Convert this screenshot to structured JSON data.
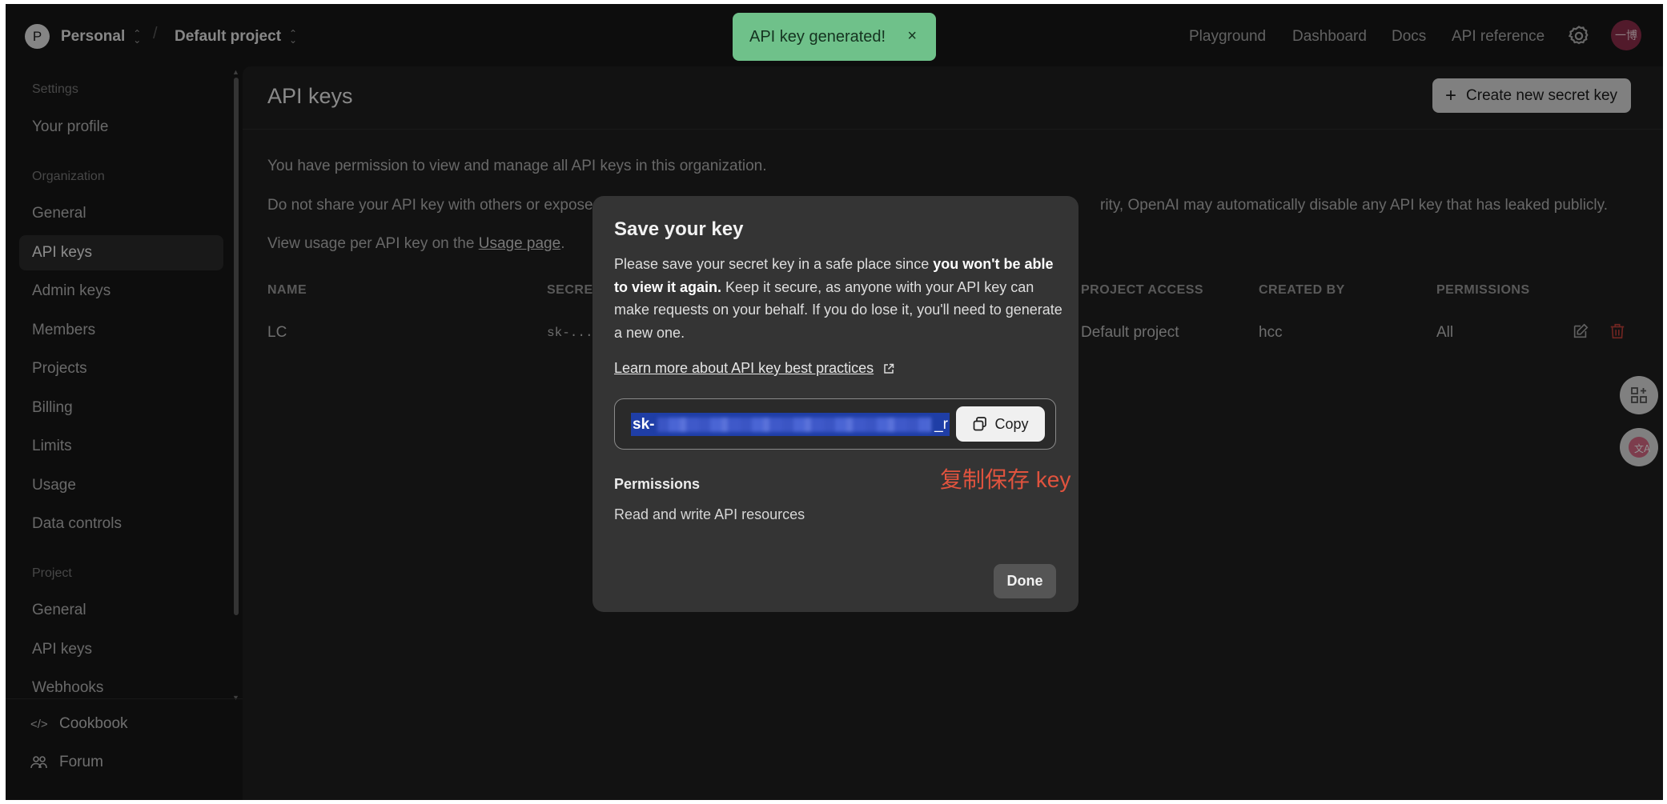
{
  "topbar": {
    "org_initial": "P",
    "org_name": "Personal",
    "project_name": "Default project",
    "separator": "/",
    "nav": [
      "Playground",
      "Dashboard",
      "Docs",
      "API reference"
    ],
    "user_avatar_text": "一博"
  },
  "toast": {
    "message": "API key generated!",
    "close": "×"
  },
  "sidebar": {
    "settings_heading": "Settings",
    "your_profile": "Your profile",
    "organization_heading": "Organization",
    "org_items": [
      "General",
      "API keys",
      "Admin keys",
      "Members",
      "Projects",
      "Billing",
      "Limits",
      "Usage",
      "Data controls"
    ],
    "project_heading": "Project",
    "project_items": [
      "General",
      "API keys",
      "Webhooks"
    ],
    "footer_items": [
      "Cookbook",
      "Forum"
    ]
  },
  "main": {
    "title": "API keys",
    "create_button": "Create new secret key",
    "para1": "You have permission to view and manage all API keys in this organization.",
    "para2_start": "Do not share your API key with others or expose it",
    "para2_end": "rity, OpenAI may automatically disable any API key that has leaked publicly.",
    "para3_prefix": "View usage per API key on the",
    "para3_link": "Usage page",
    "para3_suffix": ".",
    "table": {
      "headers": [
        "NAME",
        "SECRE",
        "PROJECT ACCESS",
        "CREATED BY",
        "PERMISSIONS"
      ],
      "rows": [
        {
          "name": "LC",
          "secret": "sk-...",
          "project": "Default project",
          "created_by": "hcc",
          "permissions": "All"
        }
      ]
    }
  },
  "modal": {
    "title": "Save your key",
    "body_start": "Please save your secret key in a safe place since ",
    "body_bold": "you won't be able to view it again.",
    "body_end": " Keep it secure, as anyone with your API key can make requests on your behalf. If you do lose it, you'll need to generate a new one.",
    "learn_more": "Learn more about API key best practices",
    "key_prefix": "sk-",
    "key_suffix": "_r",
    "copy_label": "Copy",
    "annotation": "复制保存 key",
    "permissions_title": "Permissions",
    "permissions_value": "Read and write API resources",
    "done_label": "Done"
  },
  "colors": {
    "toast_bg": "#6fc18a",
    "key_selection": "#1f3ea6",
    "annotation": "#e0533e",
    "delete_icon": "#c0413a"
  }
}
